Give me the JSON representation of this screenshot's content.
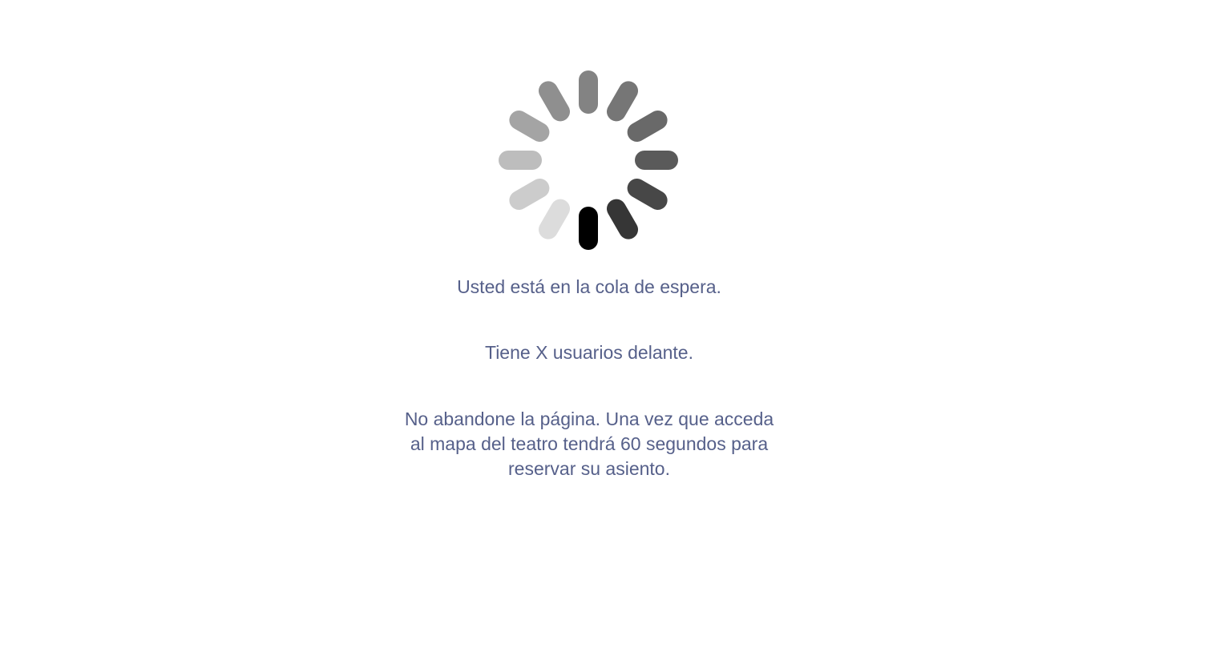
{
  "spinner": {
    "icon": "loading-spinner-icon",
    "bar_count": 12,
    "bar_colors": [
      "#000000",
      "#363636",
      "#474747",
      "#5a5a5a",
      "#696969",
      "#767676",
      "#838383",
      "#8f8f8f",
      "#a4a4a4",
      "#bdbdbd",
      "#cccccc",
      "#dcdcdc"
    ]
  },
  "queue": {
    "status_text": "Usted está en la cola de espera.",
    "ahead_text": "Tiene X usuarios delante.",
    "warning_text": "No abandone la página. Una vez que acceda al mapa del teatro tendrá 60 segundos para reservar su asiento."
  },
  "colors": {
    "text": "#56608a",
    "background": "#ffffff"
  }
}
